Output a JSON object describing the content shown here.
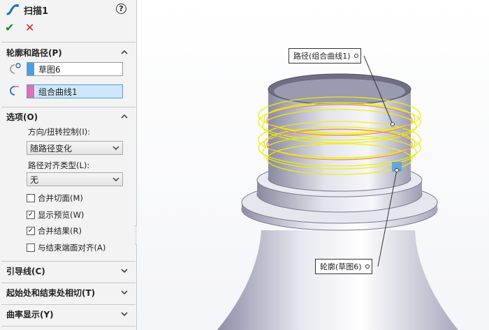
{
  "panel": {
    "title": "扫描1",
    "icon": "sweep-feature-icon",
    "help_label": "?",
    "ok_label": "✔",
    "cancel_label": "✕",
    "profile_section": {
      "label": "轮廓和路径(P)",
      "profile_value": "草图6",
      "path_value": "组合曲线1",
      "profile_color": "#4a9fe0",
      "path_color": "#e070b0"
    },
    "options_section": {
      "label": "选项(O)",
      "orientation_label": "方向/扭转控制(I):",
      "orientation_value": "随路径变化",
      "alignment_label": "路径对齐类型(L):",
      "alignment_value": "无",
      "checkboxes": [
        {
          "label": "合并切面(M)",
          "checked": false
        },
        {
          "label": "显示预览(W)",
          "checked": true
        },
        {
          "label": "合并结果(R)",
          "checked": true
        },
        {
          "label": "与结束端面对齐(A)",
          "checked": false
        }
      ]
    },
    "guide_section": {
      "label": "引导线(C)"
    },
    "tangency_section": {
      "label": "起始处和结束处相切(T)"
    },
    "curvature_section": {
      "label": "曲率显示(Y)"
    }
  },
  "viewport": {
    "path_callout": "路径(组合曲线1)",
    "profile_callout": "轮廓(草图6)",
    "highlight_color": "#f0f000",
    "body_color": "#c8c8d8"
  }
}
